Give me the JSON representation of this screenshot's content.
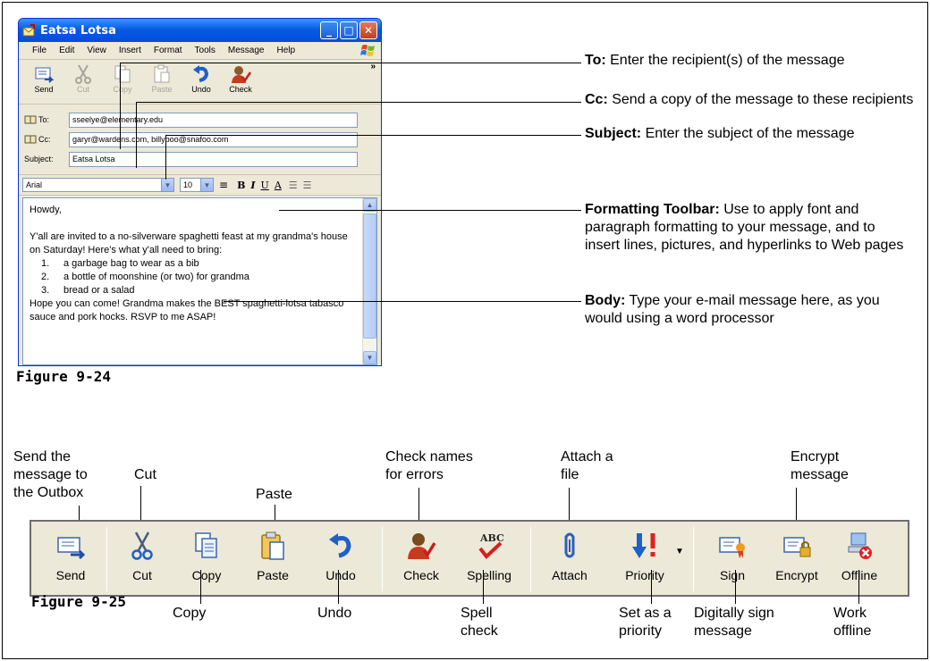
{
  "window": {
    "title": "Eatsa Lotsa",
    "controls": {
      "minimize": "_",
      "maximize": "□",
      "close": "✕"
    },
    "menu": [
      "File",
      "Edit",
      "View",
      "Insert",
      "Format",
      "Tools",
      "Message",
      "Help"
    ],
    "toolbar": [
      {
        "label": "Send",
        "icon": "send-icon",
        "disabled": false
      },
      {
        "label": "Cut",
        "icon": "scissors-icon",
        "disabled": true
      },
      {
        "label": "Copy",
        "icon": "copy-icon",
        "disabled": true
      },
      {
        "label": "Paste",
        "icon": "paste-icon",
        "disabled": true
      },
      {
        "label": "Undo",
        "icon": "undo-icon",
        "disabled": false
      },
      {
        "label": "Check",
        "icon": "check-names-icon",
        "disabled": false
      }
    ],
    "chevron": "»",
    "headers": {
      "to_label": "To:",
      "to_value": "sseelye@elementary.edu",
      "cc_label": "Cc:",
      "cc_value": "garyr@wardens.com, billyboo@snafoo.com",
      "subject_label": "Subject:",
      "subject_value": "Eatsa Lotsa"
    },
    "format": {
      "font": "Arial",
      "size": "10",
      "bold": "B",
      "italic": "I",
      "underline": "U",
      "color": "A"
    },
    "body": {
      "greeting": "Howdy,",
      "para1": "Y'all are invited to a no-silverware spaghetti feast at my grandma's house on Saturday! Here's what y'all need to bring:",
      "items": [
        {
          "n": "1.",
          "text": "a garbage bag to wear as a bib"
        },
        {
          "n": "2.",
          "text": "a bottle of moonshine (or two) for grandma"
        },
        {
          "n": "3.",
          "text": "bread or a salad"
        }
      ],
      "para2": "Hope you can come! Grandma makes the BEST spaghetti-lotsa tabasco sauce and pork hocks. RSVP to me ASAP!"
    }
  },
  "callouts": {
    "to": {
      "term": "To:",
      "desc": " Enter the recipient(s) of the message"
    },
    "cc": {
      "term": "Cc:",
      "desc": " Send a copy of the message to these recipients"
    },
    "subject": {
      "term": "Subject:",
      "desc": " Enter the subject of the message"
    },
    "formatting": {
      "term": "Formatting Toolbar:",
      "desc": " Use to apply font and paragraph formatting to your message, and to insert lines, pictures, and hyperlinks to Web pages"
    },
    "body": {
      "term": "Body:",
      "desc": " Type your e-mail message here, as you would using a word processor"
    }
  },
  "figures": {
    "fig1": "Figure 9-24",
    "fig2": "Figure 9-25"
  },
  "big_toolbar": [
    {
      "label": "Send",
      "icon": "send-icon"
    },
    {
      "label": "Cut",
      "icon": "scissors-icon"
    },
    {
      "label": "Copy",
      "icon": "copy-icon"
    },
    {
      "label": "Paste",
      "icon": "paste-icon"
    },
    {
      "label": "Undo",
      "icon": "undo-icon"
    },
    {
      "label": "Check",
      "icon": "check-names-icon"
    },
    {
      "label": "Spelling",
      "icon": "spelling-icon"
    },
    {
      "label": "Attach",
      "icon": "paperclip-icon"
    },
    {
      "label": "Priority",
      "icon": "priority-icon"
    },
    {
      "label": "Sign",
      "icon": "sign-icon"
    },
    {
      "label": "Encrypt",
      "icon": "encrypt-icon"
    },
    {
      "label": "Offline",
      "icon": "offline-icon"
    }
  ],
  "toolbar_labels": {
    "send_top": "Send the message to the Outbox",
    "cut_top": "Cut",
    "paste_top": "Paste",
    "check_top": "Check names for errors",
    "attach_top": "Attach a file",
    "encrypt_top": "Encrypt message",
    "copy_bottom": "Copy",
    "undo_bottom": "Undo",
    "spell_bottom": "Spell check",
    "priority_bottom": "Set as a priority",
    "sign_bottom": "Digitally sign message",
    "offline_bottom": "Work offline"
  }
}
